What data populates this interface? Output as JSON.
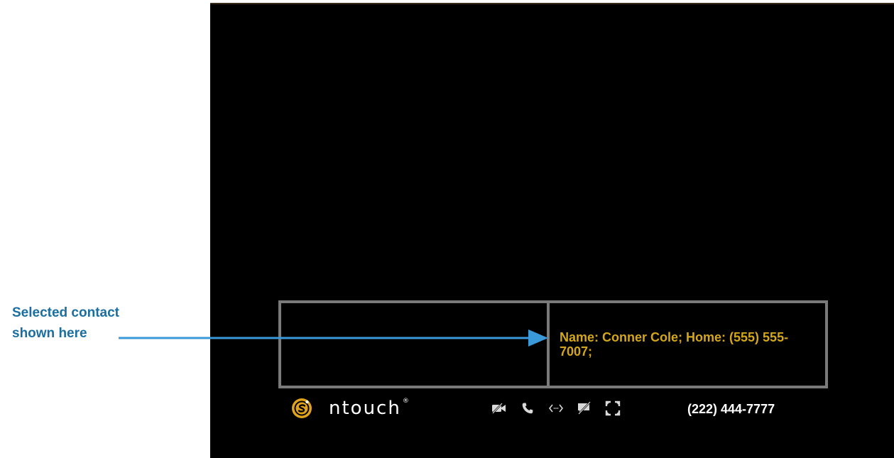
{
  "callout": {
    "line1": "Selected contact",
    "line2": "shown here"
  },
  "contact_panel": {
    "text": "Name: Conner Cole; Home: (555) 555-7007;"
  },
  "logo": {
    "text": "ntouch",
    "registered": "®"
  },
  "status_bar": {
    "icons": [
      "video-off-icon",
      "phone-icon",
      "signal-icon",
      "chat-off-icon",
      "fullscreen-icon"
    ],
    "phone_number": "(222) 444-7777"
  },
  "colors": {
    "callout": "#1a6fa0",
    "arrow": "#3a9ad9",
    "contact_text": "#d4a619",
    "panel_border": "#7a7a7a",
    "logo_accent": "#e0a31a"
  }
}
